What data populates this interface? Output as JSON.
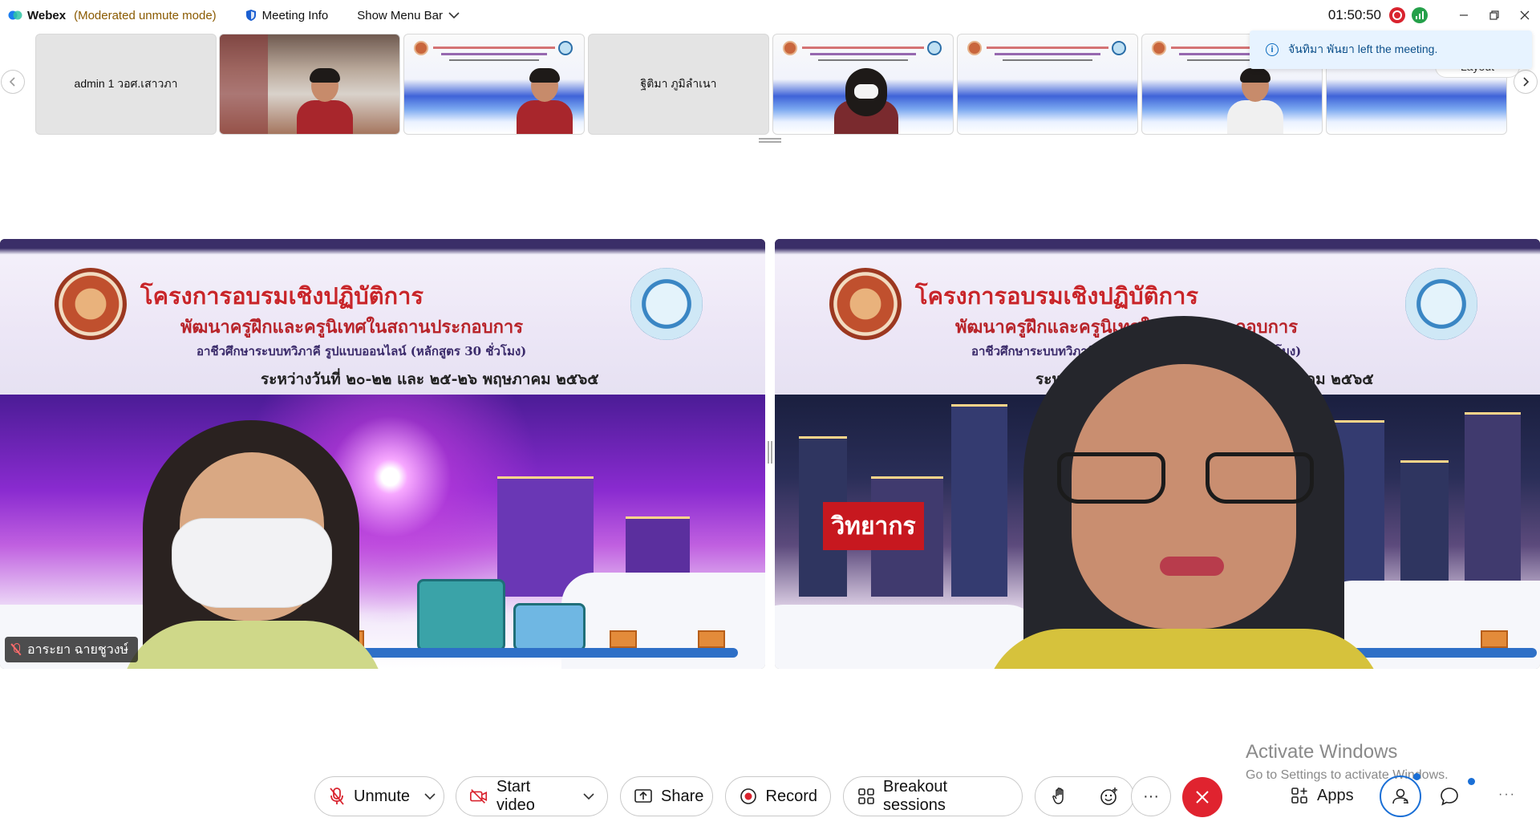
{
  "titlebar": {
    "app_name": "Webex",
    "mode": "(Moderated unmute mode)",
    "meeting_info": "Meeting Info",
    "show_menu_bar": "Show Menu Bar",
    "clock": "01:50:50"
  },
  "thumbnails": [
    {
      "type": "blank",
      "name": "admin 1 วอศ.เสาวภา"
    },
    {
      "type": "room"
    },
    {
      "type": "slide-person"
    },
    {
      "type": "blank",
      "name": "ฐิติมา ภูมิลำเนา"
    },
    {
      "type": "slide-mask"
    },
    {
      "type": "slide"
    },
    {
      "type": "slide-person"
    },
    {
      "type": "slide"
    }
  ],
  "toast": {
    "message": "จันทิมา พันยา left the meeting."
  },
  "layout_button": "Layout",
  "slide": {
    "title": "โครงการอบรมเชิงปฏิบัติการ",
    "subtitle1": "พัฒนาครูฝึกและครูนิเทศในสถานประกอบการ",
    "subtitle2": "อาชีวศึกษาระบบทวิภาคี รูปแบบออนไลน์ (หลักสูตร 30 ชั่วโมง)",
    "subtitle3": "ระหว่างวันที่ ๒๐-๒๒ และ ๒๕-๒๖ พฤษภาคม ๒๕๖๕"
  },
  "video_left": {
    "name": "อาระยา ฉายชูวงษ์",
    "muted": true
  },
  "video_right": {
    "label": "วิทยากร"
  },
  "watermark": {
    "line1": "Activate Windows",
    "line2": "Go to Settings to activate Windows."
  },
  "controls": {
    "unmute": "Unmute",
    "start_video": "Start video",
    "share": "Share",
    "record": "Record",
    "breakout": "Breakout sessions",
    "apps": "Apps",
    "more": "···"
  },
  "colors": {
    "end_call": "#e0232f",
    "record": "#d9232e",
    "accent": "#1a6fd6"
  }
}
